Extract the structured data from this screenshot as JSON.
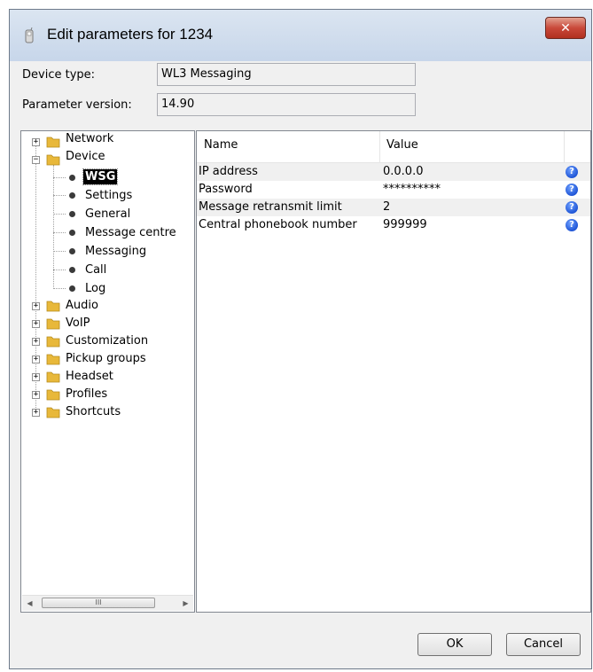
{
  "window": {
    "title": "Edit parameters for 1234",
    "close_glyph": "✕"
  },
  "fields": {
    "device_type_label": "Device type:",
    "device_type_value": "WL3 Messaging",
    "param_version_label": "Parameter version:",
    "param_version_value": "14.90"
  },
  "tree": {
    "expand_glyph": "+",
    "collapse_glyph": "−",
    "items": [
      {
        "label": "Network",
        "type": "folder",
        "expanded": false
      },
      {
        "label": "Device",
        "type": "folder",
        "expanded": true
      },
      {
        "label": "WSG",
        "type": "leaf",
        "selected": true
      },
      {
        "label": "Settings",
        "type": "leaf"
      },
      {
        "label": "General",
        "type": "leaf"
      },
      {
        "label": "Message centre",
        "type": "leaf"
      },
      {
        "label": "Messaging",
        "type": "leaf"
      },
      {
        "label": "Call",
        "type": "leaf"
      },
      {
        "label": "Log",
        "type": "leaf"
      },
      {
        "label": "Audio",
        "type": "folder",
        "expanded": false
      },
      {
        "label": "VoIP",
        "type": "folder",
        "expanded": false
      },
      {
        "label": "Customization",
        "type": "folder",
        "expanded": false
      },
      {
        "label": "Pickup groups",
        "type": "folder",
        "expanded": false
      },
      {
        "label": "Headset",
        "type": "folder",
        "expanded": false
      },
      {
        "label": "Profiles",
        "type": "folder",
        "expanded": false
      },
      {
        "label": "Shortcuts",
        "type": "folder",
        "expanded": false
      }
    ],
    "scroll_left_glyph": "◀",
    "scroll_right_glyph": "▶",
    "scroll_thumb_glyph": "III"
  },
  "table": {
    "columns": [
      "Name",
      "Value"
    ],
    "rows": [
      {
        "name": "IP address",
        "value": "0.0.0.0"
      },
      {
        "name": "Password",
        "value": "**********"
      },
      {
        "name": "Message retransmit limit",
        "value": "2"
      },
      {
        "name": "Central phonebook number",
        "value": "999999"
      }
    ],
    "help_glyph": "?"
  },
  "buttons": {
    "ok": "OK",
    "cancel": "Cancel"
  },
  "colors": {
    "folder": "#e8b83a",
    "help": "#1f55d6",
    "close": "#c9493a"
  }
}
